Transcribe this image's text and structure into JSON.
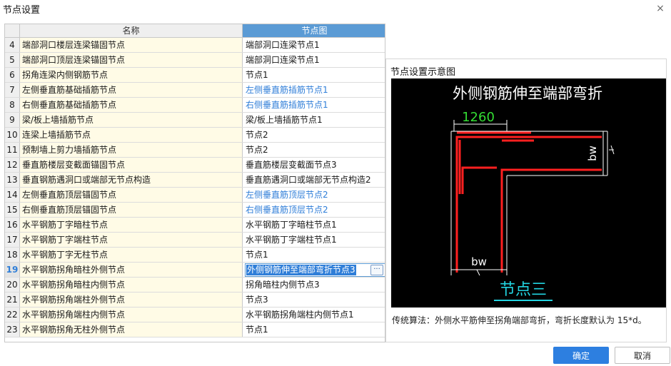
{
  "window": {
    "title": "节点设置",
    "close": "×"
  },
  "grid": {
    "columns": {
      "name": "名称",
      "node": "节点图"
    },
    "rows": [
      {
        "num": "4",
        "name": "端部洞口楼层连梁锚固节点",
        "node": "端部洞口连梁节点1",
        "link": false
      },
      {
        "num": "5",
        "name": "端部洞口顶层连梁锚固节点",
        "node": "端部洞口连梁节点1",
        "link": false
      },
      {
        "num": "6",
        "name": "拐角连梁内侧钢筋节点",
        "node": "节点1",
        "link": false
      },
      {
        "num": "7",
        "name": "左侧垂直筋基础插筋节点",
        "node": "左侧垂直筋插筋节点1",
        "link": true
      },
      {
        "num": "8",
        "name": "右侧垂直筋基础插筋节点",
        "node": "右侧垂直筋插筋节点1",
        "link": true
      },
      {
        "num": "9",
        "name": "梁/板上墙插筋节点",
        "node": "梁/板上墙插筋节点1",
        "link": false
      },
      {
        "num": "10",
        "name": "连梁上墙插筋节点",
        "node": "节点2",
        "link": false
      },
      {
        "num": "11",
        "name": "预制墙上剪力墙插筋节点",
        "node": "节点2",
        "link": false
      },
      {
        "num": "12",
        "name": "垂直筋楼层变截面锚固节点",
        "node": "垂直筋楼层变截面节点3",
        "link": false
      },
      {
        "num": "13",
        "name": "垂直钢筋遇洞口或端部无节点构造",
        "node": "垂直筋遇洞口或端部无节点构造2",
        "link": false
      },
      {
        "num": "14",
        "name": "左侧垂直筋顶层锚固节点",
        "node": "左侧垂直筋顶层节点2",
        "link": true
      },
      {
        "num": "15",
        "name": "右侧垂直筋顶层锚固节点",
        "node": "右侧垂直筋顶层节点2",
        "link": true
      },
      {
        "num": "16",
        "name": "水平钢筋丁字暗柱节点",
        "node": "水平钢筋丁字暗柱节点1",
        "link": false
      },
      {
        "num": "17",
        "name": "水平钢筋丁字端柱节点",
        "node": "水平钢筋丁字端柱节点1",
        "link": false
      },
      {
        "num": "18",
        "name": "水平钢筋丁字无柱节点",
        "node": "节点1",
        "link": false
      },
      {
        "num": "19",
        "name": "水平钢筋拐角暗柱外侧节点",
        "node": "外侧钢筋伸至端部弯折节点3",
        "link": false,
        "selected": true
      },
      {
        "num": "20",
        "name": "水平钢筋拐角暗柱内侧节点",
        "node": "拐角暗柱内侧节点3",
        "link": false
      },
      {
        "num": "21",
        "name": "水平钢筋拐角端柱外侧节点",
        "node": "节点3",
        "link": false
      },
      {
        "num": "22",
        "name": "水平钢筋拐角端柱内侧节点",
        "node": "水平钢筋拐角端柱内侧节点1",
        "link": false
      },
      {
        "num": "23",
        "name": "水平钢筋拐角无柱外侧节点",
        "node": "节点1",
        "link": false
      }
    ],
    "edit_button": "···"
  },
  "panel": {
    "title": "节点设置示意图",
    "diagram": {
      "heading": "外侧钢筋伸至端部弯折",
      "dim_top": "1260",
      "dim_side": "bw",
      "dim_bottom": "bw",
      "node_label": "节点三",
      "colors": {
        "background": "#000000",
        "rebar": "#ff2020",
        "outline": "#ffffff",
        "dim_text": "#33dd33",
        "label": "#22d3e0"
      }
    },
    "algorithm": "传统算法：外侧水平筋伸至拐角端部弯折，弯折长度默认为 15*d。"
  },
  "buttons": {
    "ok": "确定",
    "cancel": "取消"
  },
  "colors": {
    "accent": "#2d7fe0",
    "header_selected": "#5b9bd5",
    "link": "#2f7ed8",
    "name_cell": "#fffbe6"
  }
}
